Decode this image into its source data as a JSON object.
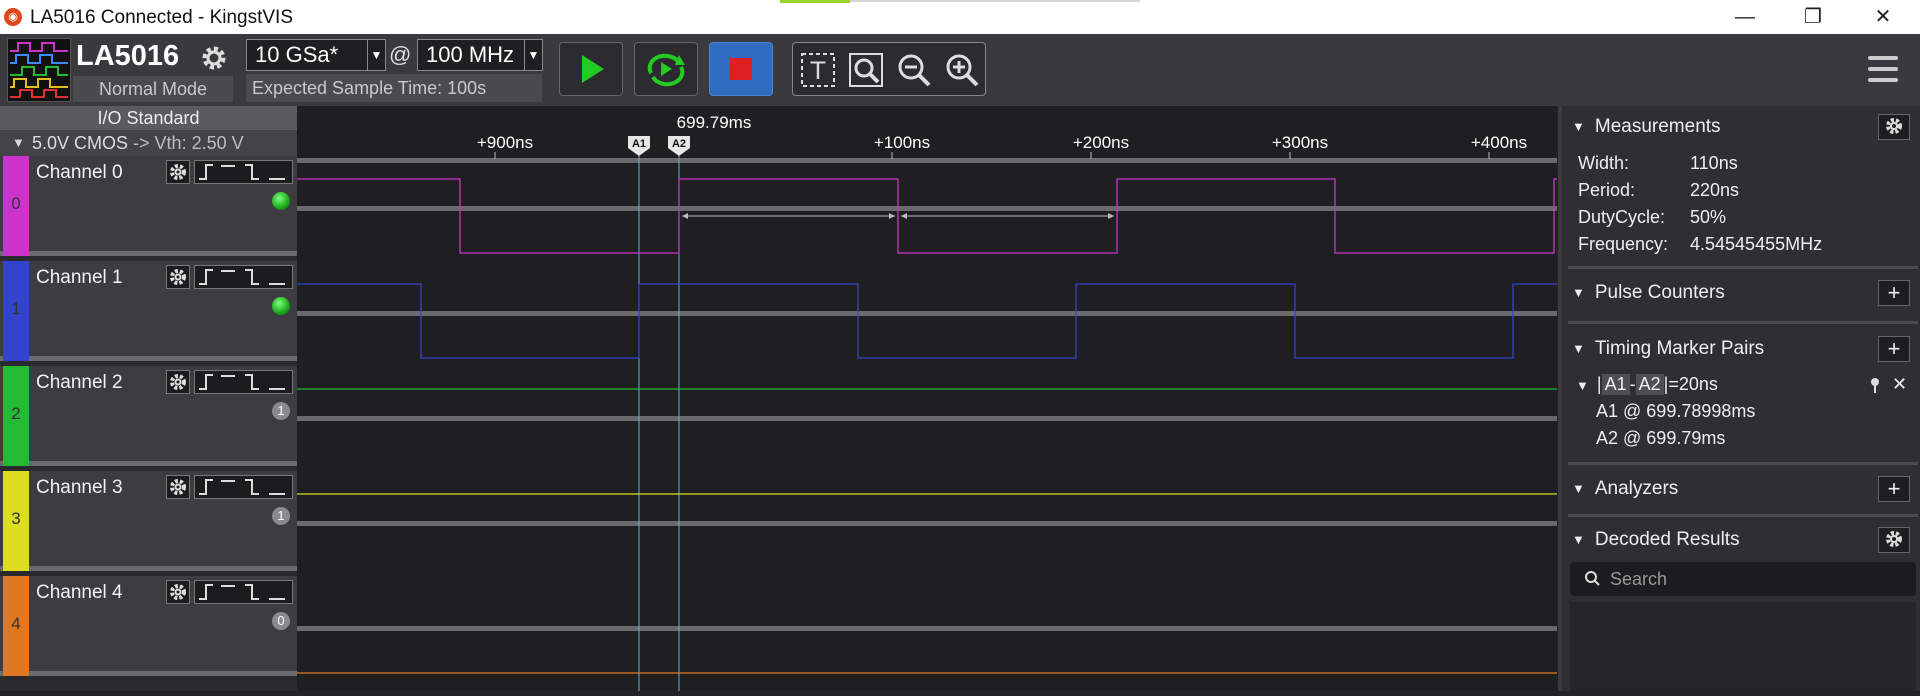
{
  "window": {
    "title": "LA5016 Connected - KingstVIS",
    "minimize": "—",
    "maximize": "❐",
    "close": "✕"
  },
  "device": {
    "name": "LA5016",
    "mode": "Normal Mode"
  },
  "sampling": {
    "depth": "10 GSa*",
    "at": "@",
    "rate": "100 MHz",
    "expected": "Expected Sample Time: 100s"
  },
  "io": {
    "header": "I/O Standard",
    "standard": "5.0V CMOS",
    "vth": "-> Vth: 2.50 V"
  },
  "channels": [
    {
      "num": "0",
      "name": "Channel 0",
      "color": "#cc33cc",
      "status": "led"
    },
    {
      "num": "1",
      "name": "Channel 1",
      "color": "#3344cc",
      "status": "led"
    },
    {
      "num": "2",
      "name": "Channel 2",
      "color": "#22bb33",
      "status": "1"
    },
    {
      "num": "3",
      "name": "Channel 3",
      "color": "#dddd22",
      "status": "1"
    },
    {
      "num": "4",
      "name": "Channel 4",
      "color": "#e07722",
      "status": "0"
    }
  ],
  "timeline": {
    "ticks": [
      "+900ns",
      "+100ns",
      "+200ns",
      "+300ns",
      "+400ns"
    ],
    "cursor_label": "699.79ms",
    "marker_a1": "A1",
    "marker_a2": "A2"
  },
  "measurements": {
    "title": "Measurements",
    "width_label": "Width:",
    "width_value": "110ns",
    "period_label": "Period:",
    "period_value": "220ns",
    "duty_label": "DutyCycle:",
    "duty_value": "50%",
    "freq_label": "Frequency:",
    "freq_value": "4.54545455MHz"
  },
  "pulse_counters": {
    "title": "Pulse Counters"
  },
  "timing_pairs": {
    "title": "Timing Marker Pairs",
    "a1": "A1",
    "dash": "-",
    "a2": "A2",
    "diff": "=20ns",
    "a1_line": "A1 @ 699.78998ms",
    "a2_line": "A2 @ 699.79ms"
  },
  "analyzers": {
    "title": "Analyzers"
  },
  "decoded": {
    "title": "Decoded Results",
    "search_placeholder": "Search"
  },
  "colors": {
    "accent": "#2f6bbf",
    "play": "#22cc22",
    "stop": "#e02020"
  }
}
